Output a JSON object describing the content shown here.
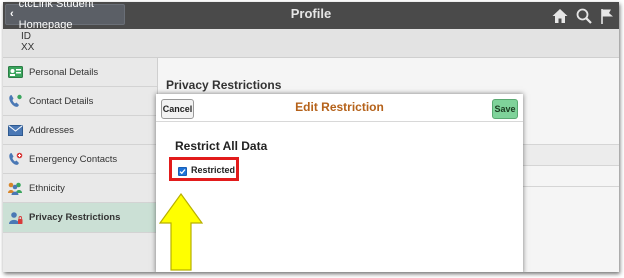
{
  "header": {
    "home_link": "ctcLink Student Homepage",
    "title": "Profile",
    "icons": [
      "home-icon",
      "search-icon",
      "flag-icon"
    ]
  },
  "id_strip": {
    "id_label": "ID",
    "id_value": "XX"
  },
  "sidebar": {
    "items": [
      {
        "label": "Personal Details",
        "icon": "personal-card-icon"
      },
      {
        "label": "Contact Details",
        "icon": "phone-icon"
      },
      {
        "label": "Addresses",
        "icon": "envelope-icon"
      },
      {
        "label": "Emergency Contacts",
        "icon": "emergency-phone-icon"
      },
      {
        "label": "Ethnicity",
        "icon": "people-icon"
      },
      {
        "label": "Privacy Restrictions",
        "icon": "privacy-person-icon",
        "active": true
      }
    ]
  },
  "main": {
    "section_title": "Privacy Restrictions"
  },
  "modal": {
    "cancel_label": "Cancel",
    "title": "Edit Restriction",
    "save_label": "Save",
    "heading": "Restrict All Data",
    "checkbox_label": "Restricted",
    "checkbox_checked": true
  },
  "colors": {
    "header_bg": "#4a4a4a",
    "modal_title": "#b5621a",
    "save_button": "#7fd39a",
    "highlight_box": "#e21b1b",
    "arrow_fill": "#ffff00",
    "active_nav": "#cbe0d5"
  }
}
